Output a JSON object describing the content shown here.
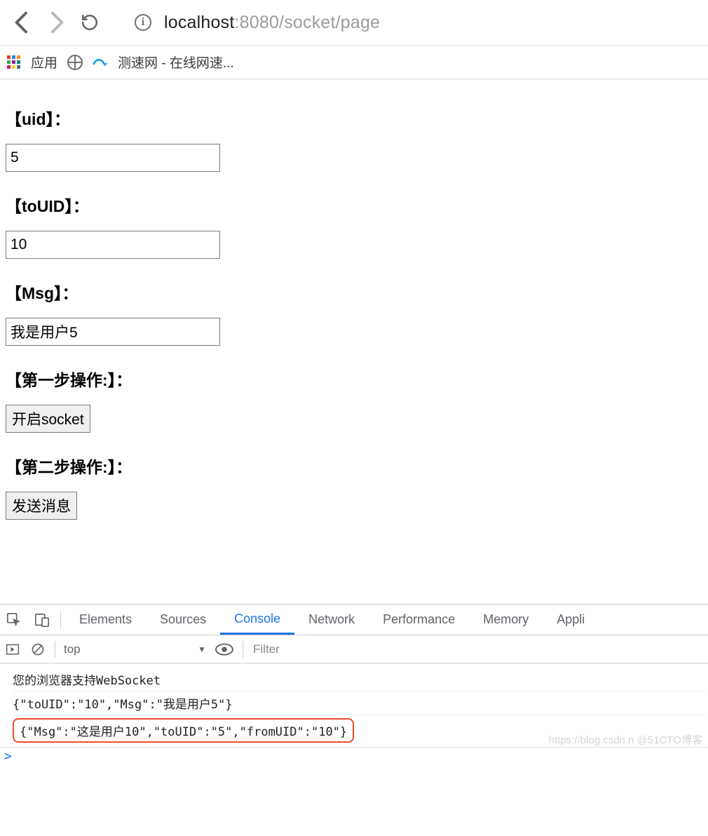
{
  "browser": {
    "url_host": "localhost",
    "url_rest": ":8080/socket/page",
    "bookmarks": {
      "apps_label": "应用",
      "speed_label": "测速网 - 在线网速..."
    }
  },
  "form": {
    "labels": {
      "uid": "【uid】：",
      "toUID": "【toUID】：",
      "msg": "【Msg】：",
      "step1": "【第一步操作:】：",
      "step2": "【第二步操作:】："
    },
    "values": {
      "uid": "5",
      "toUID": "10",
      "msg": "我是用户5"
    },
    "buttons": {
      "open_socket": "开启socket",
      "send_msg": "发送消息"
    }
  },
  "devtools": {
    "tabs": {
      "elements": "Elements",
      "sources": "Sources",
      "console": "Console",
      "network": "Network",
      "performance": "Performance",
      "memory": "Memory",
      "application": "Appli"
    },
    "context_label": "top",
    "filter_placeholder": "Filter",
    "console_lines": {
      "l0": "您的浏览器支持WebSocket",
      "l1": "{\"toUID\":\"10\",\"Msg\":\"我是用户5\"}",
      "l2": "{\"Msg\":\"这是用户10\",\"toUID\":\"5\",\"fromUID\":\"10\"}"
    }
  },
  "watermark": "https://blog.csdn.n @51CTO博客"
}
